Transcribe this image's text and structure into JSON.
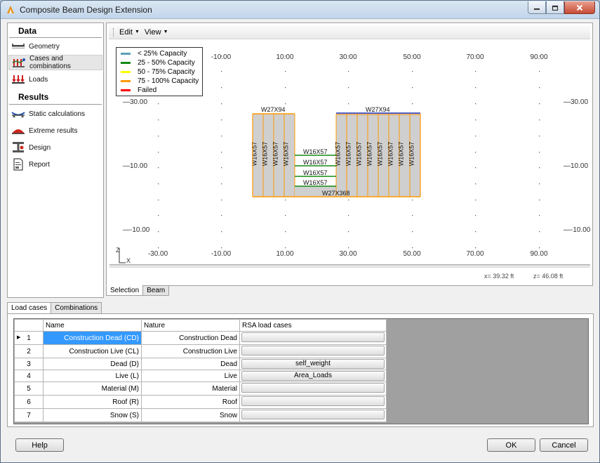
{
  "window": {
    "title": "Composite Beam Design Extension"
  },
  "nav": {
    "data_header": "Data",
    "results_header": "Results",
    "items": [
      {
        "label": "Geometry"
      },
      {
        "label": "Cases and combinations"
      },
      {
        "label": "Loads"
      },
      {
        "label": "Static calculations"
      },
      {
        "label": "Extreme results"
      },
      {
        "label": "Design"
      },
      {
        "label": "Report"
      }
    ]
  },
  "toolbar": {
    "edit_label": "Edit",
    "view_label": "View"
  },
  "legend": [
    {
      "label": "< 25% Capacity",
      "color": "#5aa0b4"
    },
    {
      "label": "25 - 50% Capacity",
      "color": "#138a13"
    },
    {
      "label": "50 - 75% Capacity",
      "color": "#ffff00"
    },
    {
      "label": "75 - 100% Capacity",
      "color": "#ff9900"
    },
    {
      "label": "Failed",
      "color": "#ff0000"
    }
  ],
  "axes": {
    "x_ticks": [
      "-30.00",
      "-10.00",
      "10.00",
      "30.00",
      "50.00",
      "70.00",
      "90.00"
    ],
    "top_x_ticks": [
      "-10.00",
      "10.00",
      "30.00",
      "50.00",
      "70.00",
      "90.00"
    ],
    "y_ticks": [
      "30.00",
      "10.00",
      "-10.00"
    ],
    "axis_letters": {
      "vertical": "Z",
      "horizontal": "X"
    }
  },
  "model": {
    "top_beam_left": "W27X94",
    "top_beam_right": "W27X94",
    "bottom_beam": "W27X368",
    "column_label": "W16X57",
    "infill_labels": [
      "W16X57",
      "W16X57",
      "W16X57",
      "W16X57"
    ]
  },
  "status": {
    "x_coord": "x= 39.32 ft",
    "z_coord": "z= 46.08 ft"
  },
  "view_tabs": [
    "Selection",
    "Beam"
  ],
  "bottom_tabs": [
    "Load cases",
    "Combinations"
  ],
  "table": {
    "columns": [
      "Name",
      "Nature",
      "RSA load cases"
    ],
    "rows": [
      {
        "num": "1",
        "name": "Construction Dead (CD)",
        "nature": "Construction Dead",
        "rsa": ""
      },
      {
        "num": "2",
        "name": "Construction Live (CL)",
        "nature": "Construction Live",
        "rsa": ""
      },
      {
        "num": "3",
        "name": "Dead (D)",
        "nature": "Dead",
        "rsa": "self_weight"
      },
      {
        "num": "4",
        "name": "Live (L)",
        "nature": "Live",
        "rsa": "Area_Loads"
      },
      {
        "num": "5",
        "name": "Material (M)",
        "nature": "Material",
        "rsa": ""
      },
      {
        "num": "6",
        "name": "Roof (R)",
        "nature": "Roof",
        "rsa": ""
      },
      {
        "num": "7",
        "name": "Snow (S)",
        "nature": "Snow",
        "rsa": ""
      }
    ]
  },
  "buttons": {
    "help": "Help",
    "ok": "OK",
    "cancel": "Cancel"
  }
}
